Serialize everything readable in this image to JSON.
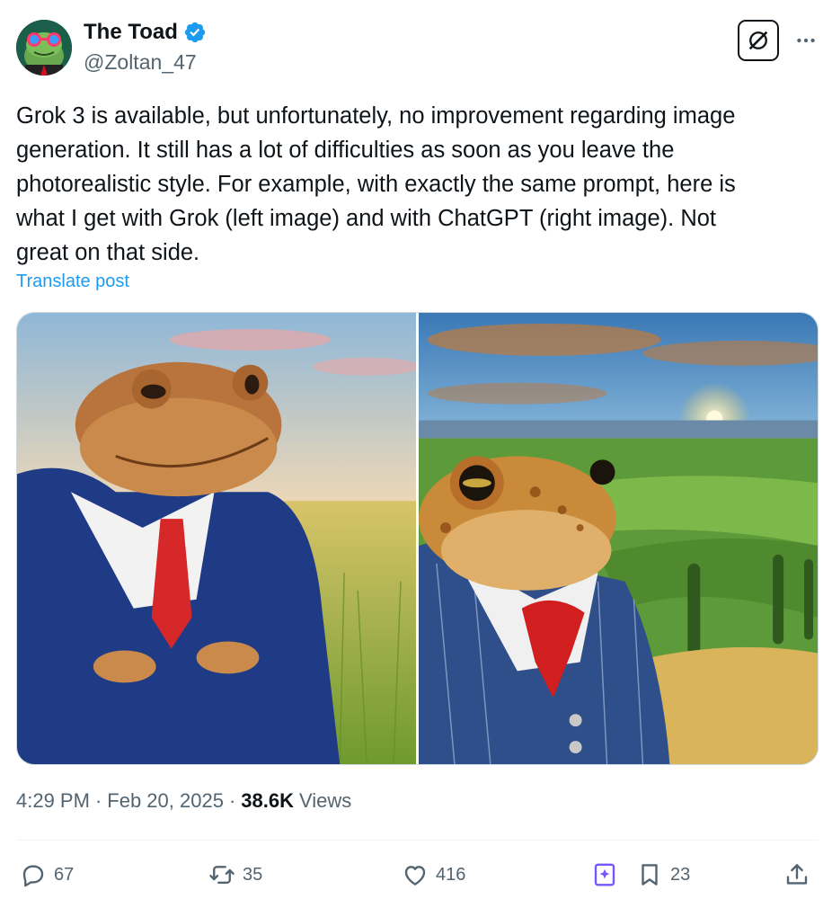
{
  "author": {
    "display_name": "The Toad",
    "handle": "@Zoltan_47",
    "verified_icon": "verified-badge-icon",
    "accent": "#1d9bf0"
  },
  "post": {
    "text": "Grok 3 is available, but unfortunately, no improvement regarding image\ngeneration. It still has a lot of difficulties as soon as you leave the\nphotorealistic style. For example, with exactly the same prompt, here is\nwhat I get with Grok (left image) and with ChatGPT (right image). Not\ngreat on that side.",
    "translate_label": "Translate post"
  },
  "media": {
    "left_image_icon": "toad-in-suit-image",
    "right_image_icon": "toad-in-pinstripe-suit-image"
  },
  "meta": {
    "time": "4:29 PM",
    "date": "Feb 20, 2025",
    "views_count": "38.6K",
    "views_label": "Views",
    "separator": "·"
  },
  "actions": {
    "replies": "67",
    "reposts": "35",
    "likes": "416",
    "bookmarks": "23"
  }
}
